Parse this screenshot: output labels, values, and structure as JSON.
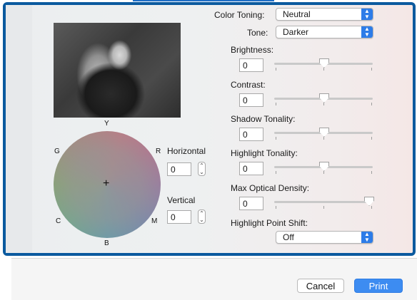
{
  "color_toning": {
    "label": "Color Toning:",
    "value": "Neutral"
  },
  "tone": {
    "label": "Tone:",
    "value": "Darker"
  },
  "sliders": [
    {
      "label": "Brightness:",
      "value": "0",
      "level": 0.5
    },
    {
      "label": "Contrast:",
      "value": "0",
      "level": 0.5
    },
    {
      "label": "Shadow Tonality:",
      "value": "0",
      "level": 0.5
    },
    {
      "label": "Highlight Tonality:",
      "value": "0",
      "level": 0.5
    },
    {
      "label": "Max Optical Density:",
      "value": "0",
      "level": 1.0
    }
  ],
  "highlight_point_shift": {
    "label": "Highlight Point Shift:",
    "value": "Off"
  },
  "wheel": {
    "y": "Y",
    "g": "G",
    "r": "R",
    "c": "C",
    "m": "M",
    "b": "B"
  },
  "horizontal": {
    "label": "Horizontal",
    "value": "0"
  },
  "vertical": {
    "label": "Vertical",
    "value": "0"
  },
  "buttons": {
    "cancel": "Cancel",
    "print": "Print"
  },
  "colors": {
    "panel_border": "#0b5a9f",
    "accent": "#3d8cf1"
  },
  "icons": {
    "popup": "chevron-updown-icon",
    "stepper": "stepper-icon",
    "crosshair": "plus-icon"
  }
}
